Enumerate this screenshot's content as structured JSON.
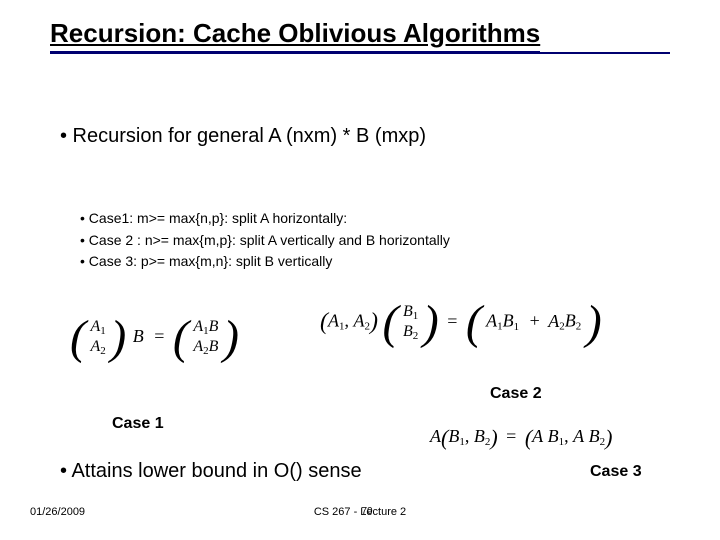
{
  "title": "Recursion: Cache Oblivious Algorithms",
  "main_bullet": "• Recursion for general A (nxm) * B (mxp)",
  "cases": {
    "c1": "•  Case1: m>= max{n,p}: split A horizontally:",
    "c2": "•  Case 2 : n>= max{m,p}: split A vertically and B horizontally",
    "c3": "•  Case 3: p>= max{m,n}: split B vertically"
  },
  "labels": {
    "case1": "Case 1",
    "case2": "Case 2",
    "case3": "Case 3"
  },
  "lower_bullet": "• Attains lower bound in O() sense",
  "footer": {
    "date": "01/26/2009",
    "center": "CS 267 - Lecture 2",
    "page": "70"
  },
  "math": {
    "A1": "A",
    "A1s": "1",
    "A2": "A",
    "A2s": "2",
    "B": "B",
    "eq": "=",
    "A1B": "A",
    "A1Bs": "1",
    "A2B": "A",
    "A2Bs": "2",
    "B1": "B",
    "B1s": "1",
    "B2": "B",
    "B2s": "2",
    "comma": ",",
    "plus": "+",
    "lpar": "(",
    "rpar": ")",
    "eq3_lhs_A": "A",
    "eq3_lhs_B1": "B",
    "eq3_lhs_B1s": "1",
    "eq3_lhs_B2": "B",
    "eq3_lhs_B2s": "2",
    "eq3_rhs_AB1_A": "A",
    "eq3_rhs_AB1_B": "B",
    "eq3_rhs_AB1_s": "1",
    "eq3_rhs_AB2_A": "A",
    "eq3_rhs_AB2_B": "B",
    "eq3_rhs_AB2_s": "2"
  }
}
